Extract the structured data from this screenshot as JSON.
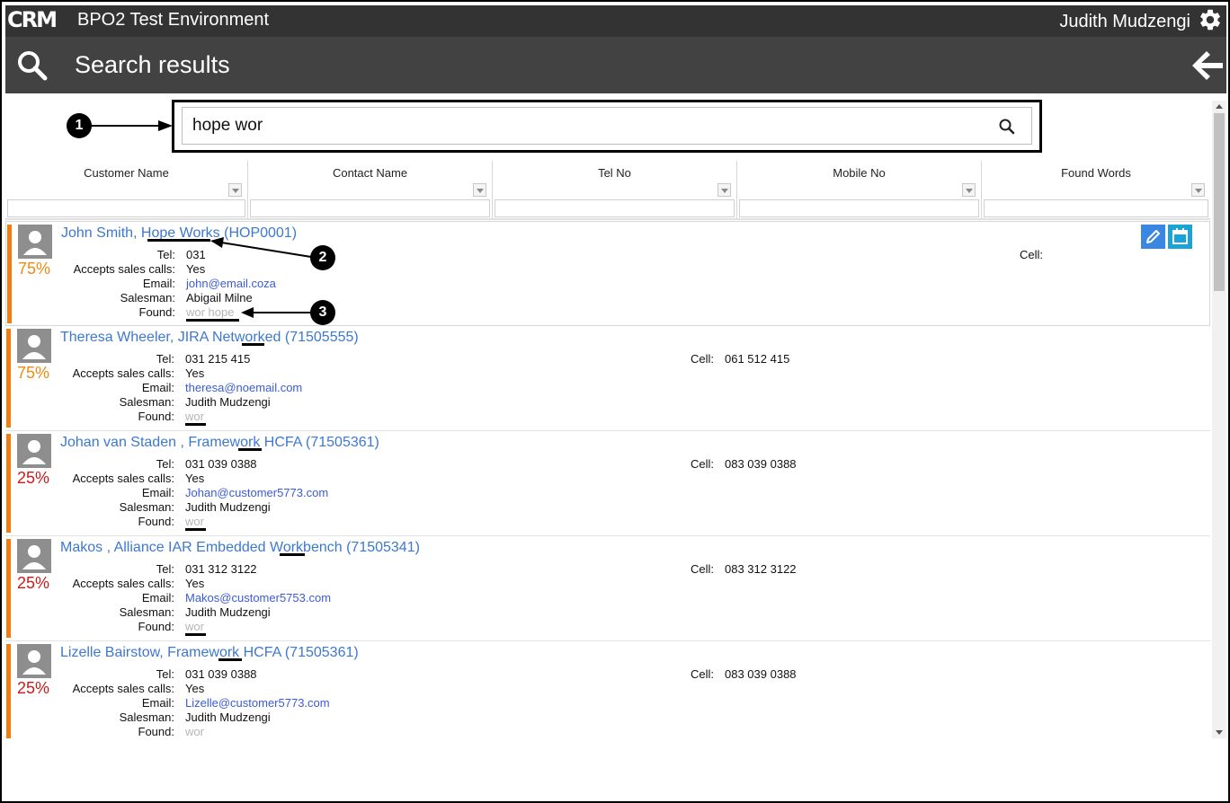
{
  "topbar": {
    "logo": "CRM",
    "app_title": "BPO2 Test Environment",
    "user_name": "Judith Mudzengi"
  },
  "header": {
    "title": "Search results"
  },
  "search": {
    "value": "hope wor"
  },
  "annotations": [
    "1",
    "2",
    "3"
  ],
  "columns": [
    "Customer Name",
    "Contact Name",
    "Tel No",
    "Mobile No",
    "Found Words"
  ],
  "field_labels": {
    "tel": "Tel:",
    "accepts": "Accepts sales calls:",
    "email": "Email:",
    "salesman": "Salesman:",
    "found": "Found:",
    "cell": "Cell:"
  },
  "results": [
    {
      "title": "John Smith, Hope Works (HOP0001)",
      "percent": "75%",
      "percent_color": "#f08a10",
      "tel": "031",
      "accepts": "Yes",
      "email": "john@email.coza",
      "salesman": "Abigail Milne",
      "found": "wor hope",
      "cell": ""
    },
    {
      "title": "Theresa Wheeler, JIRA Networked (71505555)",
      "percent": "75%",
      "percent_color": "#f08a10",
      "tel": "031 215 415",
      "accepts": "Yes",
      "email": "theresa@noemail.com",
      "salesman": "Judith Mudzengi",
      "found": "wor",
      "cell": "061 512 415"
    },
    {
      "title": "Johan van Staden , Framework HCFA (71505361)",
      "percent": "25%",
      "percent_color": "#cc1a1a",
      "tel": "031 039 0388",
      "accepts": "Yes",
      "email": "Johan@customer5773.com",
      "salesman": "Judith Mudzengi",
      "found": "wor",
      "cell": "083 039 0388"
    },
    {
      "title": "Makos , Alliance IAR Embedded Workbench (71505341)",
      "percent": "25%",
      "percent_color": "#cc1a1a",
      "tel": "031 312 3122",
      "accepts": "Yes",
      "email": "Makos@customer5753.com",
      "salesman": "Judith Mudzengi",
      "found": "wor",
      "cell": "083 312 3122"
    },
    {
      "title": "Lizelle Bairstow, Framework HCFA (71505361)",
      "percent": "25%",
      "percent_color": "#cc1a1a",
      "tel": "031 039 0388",
      "accepts": "Yes",
      "email": "Lizelle@customer5773.com",
      "salesman": "Judith Mudzengi",
      "found": "wor",
      "cell": "083 039 0388"
    }
  ],
  "colors": {
    "topbar": "#333333",
    "header": "#424242",
    "link": "#3d78d0",
    "stripe": "#f07c14",
    "edit_button": "#3a86e0",
    "calendar_button": "#1aa3d4"
  }
}
